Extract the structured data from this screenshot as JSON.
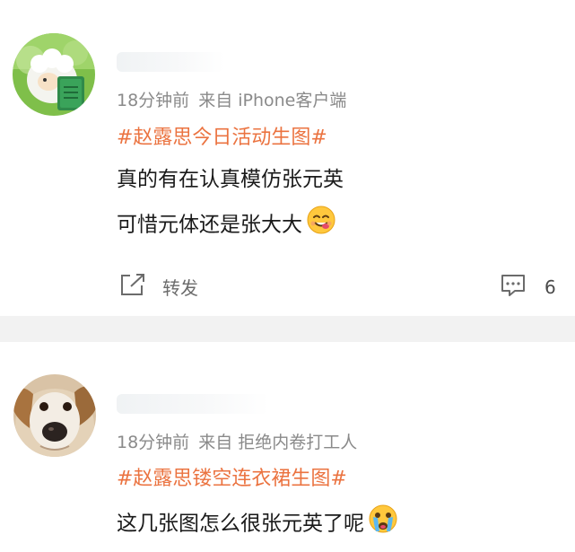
{
  "posts": [
    {
      "time": "18分钟前",
      "source": "来自 iPhone客户端",
      "topic": "#赵露思今日活动生图#",
      "lines": [
        "真的有在认真模仿张元英",
        "可惜元体还是张大大"
      ],
      "emoji": "yum-face-emoji",
      "actions": {
        "forward_label": "转发",
        "comment_count": "6"
      },
      "avatar": "sheep-reading-book-avatar"
    },
    {
      "time": "18分钟前",
      "source": "来自 拒绝内卷打工人",
      "topic": "#赵露思镂空连衣裙生图#",
      "lines": [
        "这几张图怎么很张元英了呢"
      ],
      "emoji": "crying-face-emoji",
      "avatar": "dog-face-avatar"
    }
  ],
  "colors": {
    "topic": "#eb7340",
    "meta": "#8a8a8a",
    "divider": "#f2f2f2"
  }
}
